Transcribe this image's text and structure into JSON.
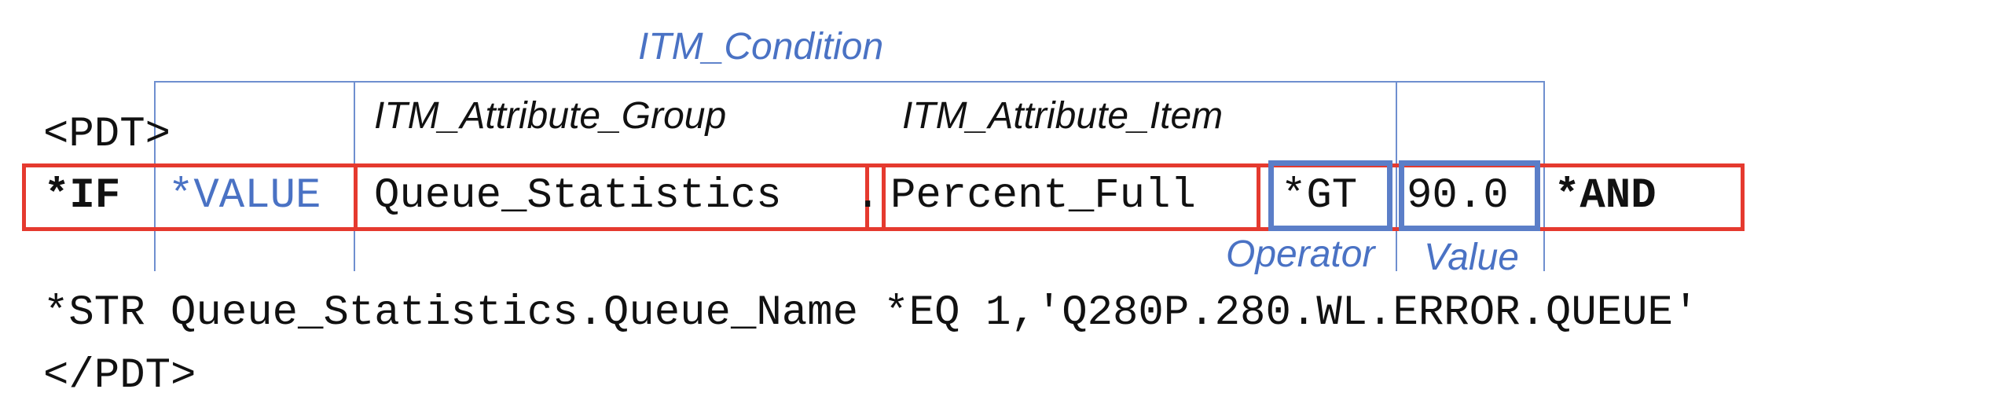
{
  "labels": {
    "condition": "ITM_Condition",
    "attribute_group": "ITM_Attribute_Group",
    "attribute_item": "ITM_Attribute_Item",
    "operator": "Operator",
    "value": "Value"
  },
  "code": {
    "open_tag": "<PDT>",
    "if_keyword": "*IF",
    "value_keyword": "*VALUE",
    "attribute_group": "Queue_Statistics",
    "dot": ".",
    "attribute_item": "Percent_Full",
    "operator": "*GT",
    "value": "90.0",
    "and_keyword": "*AND",
    "str_line": "*STR Queue_Statistics.Queue_Name *EQ 1,'Q280P.280.WL.ERROR.QUEUE'",
    "close_tag": "</PDT>"
  },
  "colors": {
    "red_box": "#e53a2f",
    "blue_box": "#5b7ec8",
    "blue_text": "#4a72c4",
    "bracket_lines": "#6f8fcf"
  }
}
